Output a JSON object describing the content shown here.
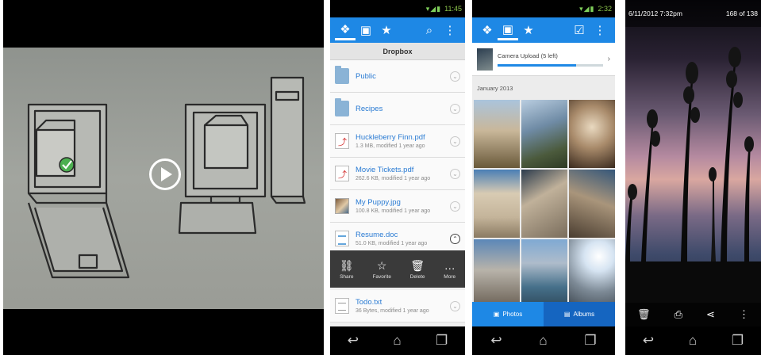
{
  "video": {
    "play_icon": "play-icon"
  },
  "file_list": {
    "statusbar": {
      "icons": "▾◢▮",
      "time": "11:45"
    },
    "actionbar": {
      "icons": [
        "dropbox-icon",
        "gallery-icon",
        "star-icon",
        "search-icon",
        "overflow-icon"
      ]
    },
    "folder_title": "Dropbox",
    "files": [
      {
        "name": "Public",
        "meta": "",
        "type": "folder"
      },
      {
        "name": "Recipes",
        "meta": "",
        "type": "folder"
      },
      {
        "name": "Huckleberry Finn.pdf",
        "meta": "1.3 MB, modified 1 year ago",
        "type": "pdf"
      },
      {
        "name": "Movie Tickets.pdf",
        "meta": "262.6 KB, modified 1 year ago",
        "type": "pdf"
      },
      {
        "name": "My Puppy.jpg",
        "meta": "100.8 KB, modified 1 year ago",
        "type": "image"
      },
      {
        "name": "Resume.doc",
        "meta": "51.0 KB, modified 1 year ago",
        "type": "doc"
      }
    ],
    "quick_actions": [
      {
        "label": "Share",
        "icon": "link-icon"
      },
      {
        "label": "Favorite",
        "icon": "star-outline-icon"
      },
      {
        "label": "Delete",
        "icon": "trash-icon"
      },
      {
        "label": "More",
        "icon": "more-icon"
      }
    ],
    "last_file": {
      "name": "Todo.txt",
      "meta": "36 Bytes, modified 1 year ago",
      "type": "txt"
    }
  },
  "photos": {
    "statusbar": {
      "icons": "▾◢▮",
      "time": "2:32"
    },
    "actionbar": {
      "icons": [
        "dropbox-icon",
        "gallery-icon",
        "star-icon",
        "select-icon",
        "overflow-icon"
      ]
    },
    "upload": {
      "label": "Camera Upload (5 left)",
      "progress": 0.75
    },
    "month": "January 2013",
    "tabs": [
      {
        "label": "Photos",
        "icon": "photo-icon"
      },
      {
        "label": "Albums",
        "icon": "album-icon"
      }
    ],
    "selected_tab": "Albums"
  },
  "lightbox": {
    "timestamp": "6/11/2012 7:32pm",
    "counter": "168 of 138",
    "actions": [
      "trash-icon",
      "export-icon",
      "share-icon",
      "overflow-icon"
    ]
  },
  "system_nav": [
    "back-icon",
    "home-icon",
    "recents-icon"
  ],
  "colors": {
    "accent": "#1e88e5",
    "accent_dark": "#1565c0",
    "link": "#2a7bd3",
    "quick_bar": "#3a3a3a"
  }
}
